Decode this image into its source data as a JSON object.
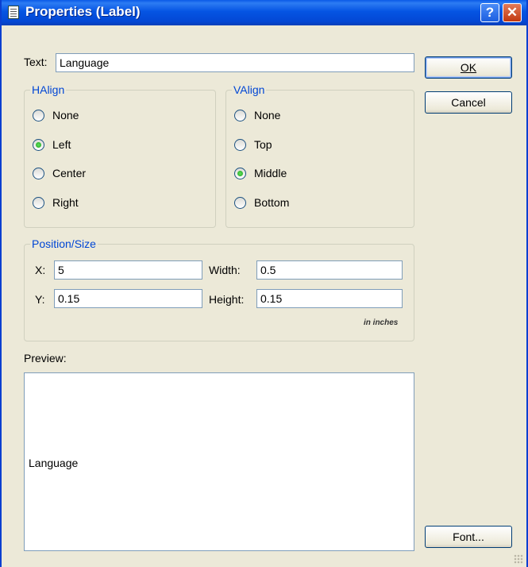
{
  "window": {
    "title": "Properties (Label)",
    "help_icon": "question-mark-icon",
    "close_icon": "close-icon"
  },
  "text_field": {
    "label": "Text:",
    "value": "Language"
  },
  "buttons": {
    "ok": "OK",
    "cancel": "Cancel",
    "font": "Font..."
  },
  "halign": {
    "title": "HAlign",
    "options": [
      "None",
      "Left",
      "Center",
      "Right"
    ],
    "selected": "Left"
  },
  "valign": {
    "title": "VAlign",
    "options": [
      "None",
      "Top",
      "Middle",
      "Bottom"
    ],
    "selected": "Middle"
  },
  "position_size": {
    "title": "Position/Size",
    "x_label": "X:",
    "x_value": "5",
    "y_label": "Y:",
    "y_value": "0.15",
    "width_label": "Width:",
    "width_value": "0.5",
    "height_label": "Height:",
    "height_value": "0.15",
    "unit_note": "in inches"
  },
  "preview": {
    "label": "Preview:",
    "text": "Language"
  },
  "colors": {
    "title_bar": "#0554e3",
    "group_title": "#0046d5",
    "dialog_bg": "#ece9d8"
  }
}
